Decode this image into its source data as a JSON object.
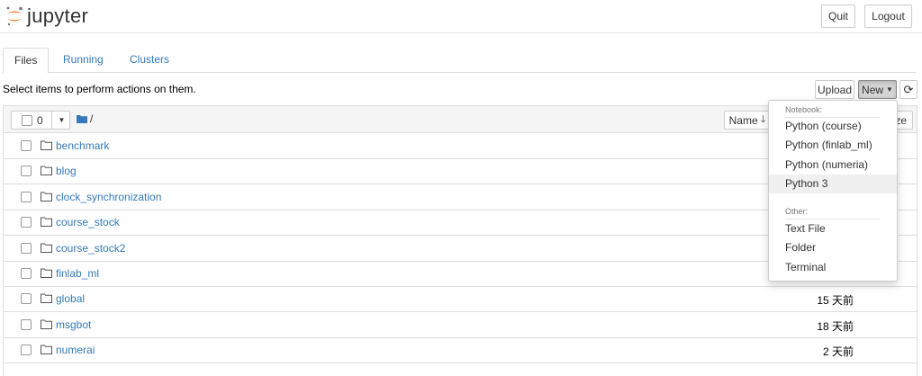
{
  "header": {
    "brand": "jupyter",
    "quit_label": "Quit",
    "logout_label": "Logout"
  },
  "tabs": [
    {
      "label": "Files"
    },
    {
      "label": "Running"
    },
    {
      "label": "Clusters"
    }
  ],
  "toolbar": {
    "notice": "Select items to perform actions on them.",
    "upload_label": "Upload",
    "new_label": "New",
    "selected_count": "0",
    "breadcrumb_root": "/",
    "sort_name_label": "Name",
    "last_modified_fragment": "ze"
  },
  "files": [
    {
      "name": "benchmark",
      "time": ""
    },
    {
      "name": "blog",
      "time": ""
    },
    {
      "name": "clock_synchronization",
      "time": ""
    },
    {
      "name": "course_stock",
      "time": ""
    },
    {
      "name": "course_stock2",
      "time": ""
    },
    {
      "name": "finlab_ml",
      "time": ""
    },
    {
      "name": "global",
      "time": "15 天前"
    },
    {
      "name": "msgbot",
      "time": "18 天前"
    },
    {
      "name": "numerai",
      "time": "2 天前"
    }
  ],
  "new_menu": {
    "notebook_header": "Notebook:",
    "notebook_items": [
      "Python (course)",
      "Python (finlab_ml)",
      "Python (numeria)",
      "Python 3"
    ],
    "other_header": "Other:",
    "other_items": [
      "Text File",
      "Folder",
      "Terminal"
    ],
    "highlighted_item": "Python 3"
  },
  "colors": {
    "link": "#337ab7",
    "logo_orange": "#f37726",
    "header_bg": "#f5f5f5"
  }
}
